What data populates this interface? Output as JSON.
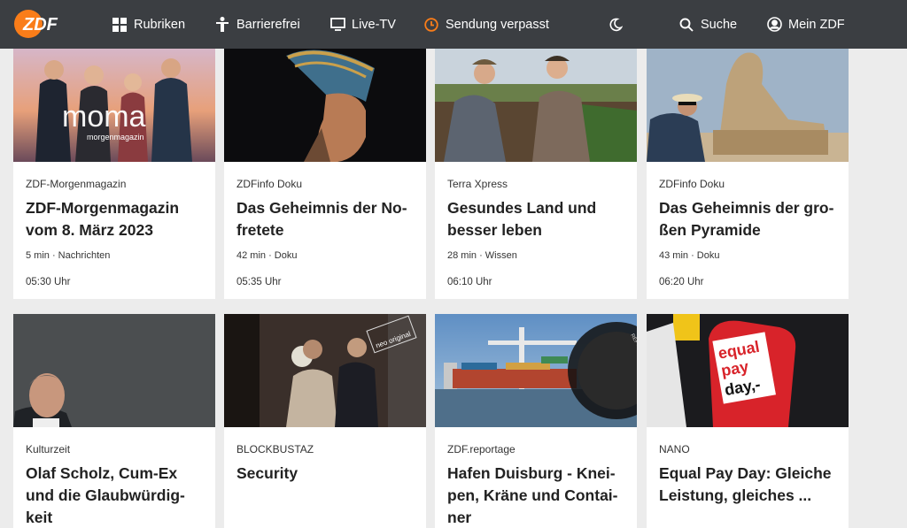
{
  "header": {
    "logo_text": "ZDF",
    "nav": [
      {
        "label": "Rubriken",
        "icon": "grid-icon"
      },
      {
        "label": "Barrierefrei",
        "icon": "accessibility-icon"
      },
      {
        "label": "Live-TV",
        "icon": "tv-icon"
      },
      {
        "label": "Sendung verpasst",
        "icon": "clock-icon"
      },
      {
        "label": "",
        "icon": "moon-icon"
      },
      {
        "label": "Suche",
        "icon": "search-icon"
      },
      {
        "label": "Mein ZDF",
        "icon": "user-icon"
      }
    ],
    "accent": "#fa7d19"
  },
  "cards": [
    {
      "overline": "ZDF-Morgenmagazin",
      "title_lines": [
        "ZDF-Morgenmagazin",
        "vom 8. März 2023"
      ],
      "info": "5 min · Nachrichten",
      "time": "05:30 Uhr",
      "thumb_brand": "moma",
      "thumb_brand_sub": "morgenmagazin"
    },
    {
      "overline": "ZDFinfo Doku",
      "title_lines": [
        "Das Geheimnis der No-",
        "fretete"
      ],
      "info": "42 min · Doku",
      "time": "05:35 Uhr"
    },
    {
      "overline": "Terra Xpress",
      "title_lines": [
        "Gesundes Land und",
        "besser leben"
      ],
      "info": "28 min · Wissen",
      "time": "06:10 Uhr"
    },
    {
      "overline": "ZDFinfo Doku",
      "title_lines": [
        "Das Geheimnis der gro-",
        "ßen Pyramide"
      ],
      "info": "43 min · Doku",
      "time": "06:20 Uhr"
    },
    {
      "overline": "Kulturzeit",
      "title_lines": [
        "Olaf Scholz, Cum-Ex",
        "und die Glaubwürdig-",
        "keit"
      ]
    },
    {
      "overline": "BLOCKBUSTAZ",
      "title_lines": [
        "Security"
      ],
      "thumb_brand": "neo original"
    },
    {
      "overline": "ZDF.reportage",
      "title_lines": [
        "Hafen Duisburg - Knei-",
        "pen, Kräne und Contai-",
        "ner"
      ],
      "thumb_brand": "REPORTAGE"
    },
    {
      "overline": "NANO",
      "title_lines": [
        "Equal Pay Day: Gleiche",
        "Leistung, gleiches ..."
      ],
      "thumb_brand_lines": [
        "equal",
        "pay",
        "day,-"
      ]
    }
  ]
}
